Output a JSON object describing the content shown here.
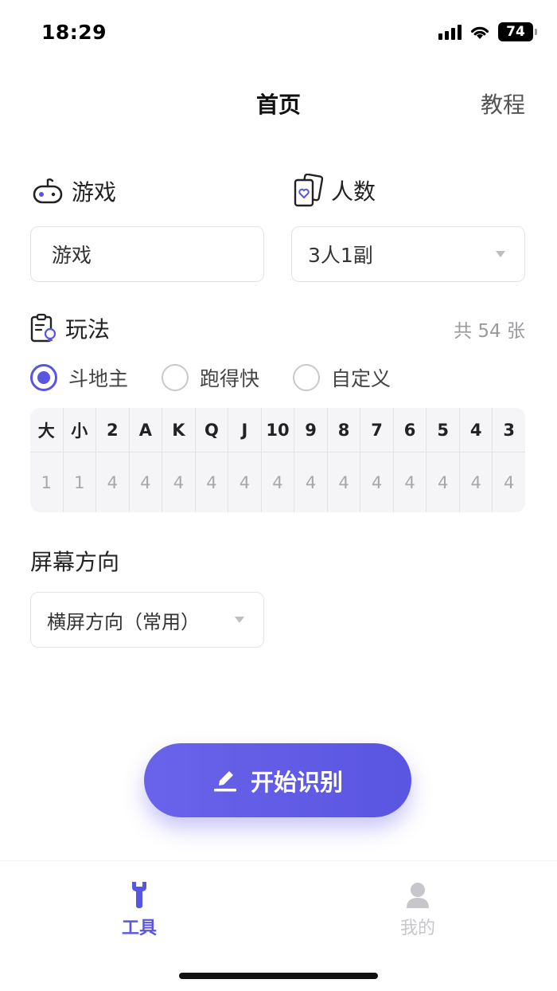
{
  "status_bar": {
    "time": "18:29",
    "battery": "74"
  },
  "nav": {
    "title": "首页",
    "right_label": "教程"
  },
  "game": {
    "label": "游戏",
    "value": "游戏"
  },
  "players": {
    "label": "人数",
    "selected": "3人1副"
  },
  "rules": {
    "label": "玩法",
    "count_text": "共 54 张",
    "options": [
      {
        "label": "斗地主",
        "checked": true
      },
      {
        "label": "跑得快",
        "checked": false
      },
      {
        "label": "自定义",
        "checked": false
      }
    ]
  },
  "cards": [
    {
      "rank": "大",
      "count": "1"
    },
    {
      "rank": "小",
      "count": "1"
    },
    {
      "rank": "2",
      "count": "4"
    },
    {
      "rank": "A",
      "count": "4"
    },
    {
      "rank": "K",
      "count": "4"
    },
    {
      "rank": "Q",
      "count": "4"
    },
    {
      "rank": "J",
      "count": "4"
    },
    {
      "rank": "10",
      "count": "4"
    },
    {
      "rank": "9",
      "count": "4"
    },
    {
      "rank": "8",
      "count": "4"
    },
    {
      "rank": "7",
      "count": "4"
    },
    {
      "rank": "6",
      "count": "4"
    },
    {
      "rank": "5",
      "count": "4"
    },
    {
      "rank": "4",
      "count": "4"
    },
    {
      "rank": "3",
      "count": "4"
    }
  ],
  "orientation": {
    "label": "屏幕方向",
    "selected": "横屏方向（常用）"
  },
  "start_button": {
    "label": "开始识别",
    "icon": "pencil-icon"
  },
  "tabs": [
    {
      "label": "工具",
      "icon": "wrench-icon",
      "active": true
    },
    {
      "label": "我的",
      "icon": "user-icon",
      "active": false
    }
  ],
  "colors": {
    "accent": "#5855e0",
    "muted": "#c7c7cb"
  }
}
